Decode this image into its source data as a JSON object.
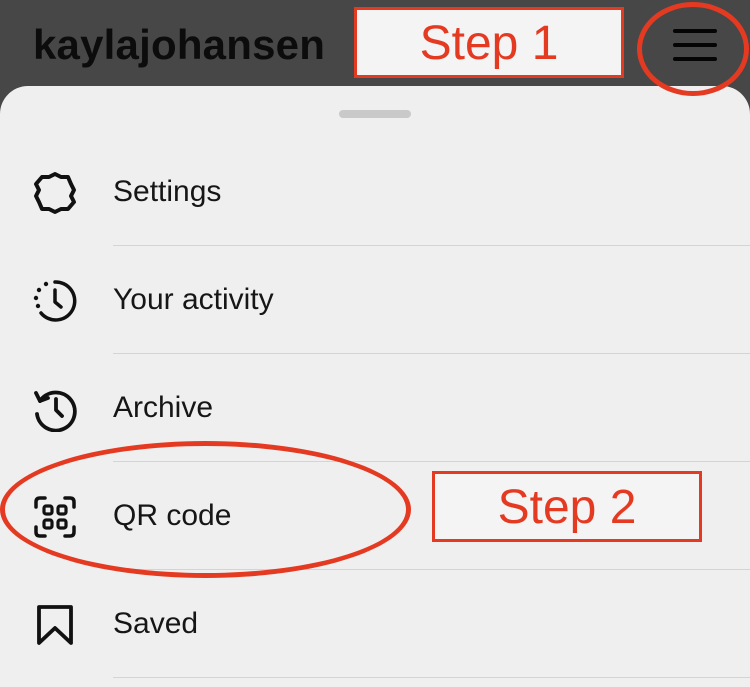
{
  "header": {
    "username": "kaylajohansen"
  },
  "menu": {
    "items": [
      {
        "label": "Settings",
        "icon": "settings-gear-icon"
      },
      {
        "label": "Your activity",
        "icon": "activity-clock-icon"
      },
      {
        "label": "Archive",
        "icon": "archive-history-icon"
      },
      {
        "label": "QR code",
        "icon": "qr-code-icon"
      },
      {
        "label": "Saved",
        "icon": "bookmark-icon"
      }
    ]
  },
  "annotations": {
    "step1": "Step 1",
    "step2": "Step 2",
    "color": "#e53a22"
  },
  "colors": {
    "header_background": "#474747",
    "sheet_background": "#efefef"
  }
}
